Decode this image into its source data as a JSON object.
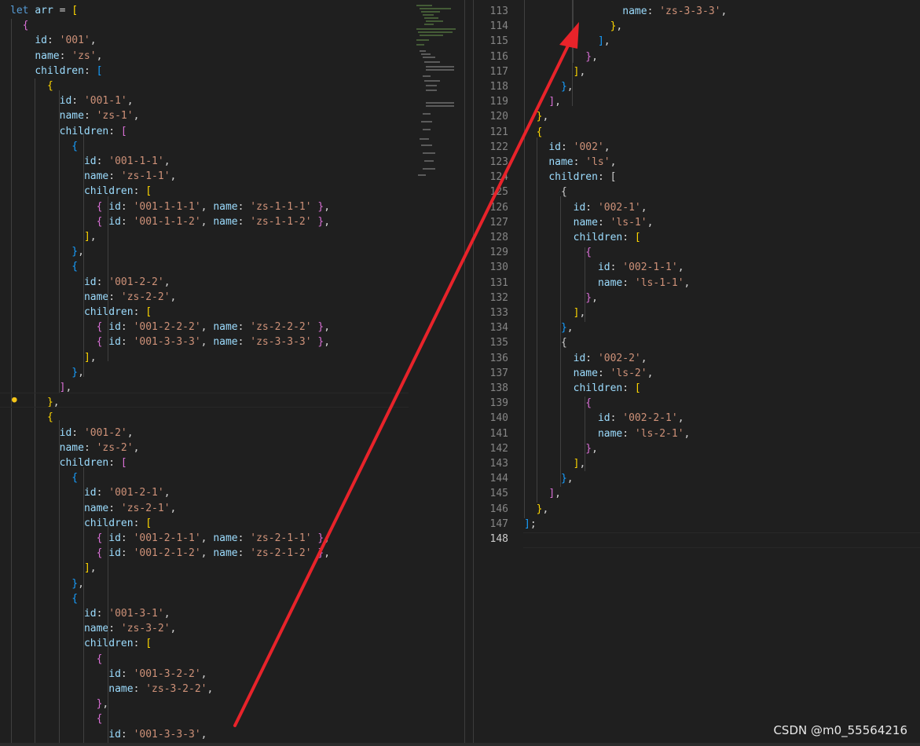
{
  "left_lines": [
    "let arr = [",
    "  {",
    "    id: '001',",
    "    name: 'zs',",
    "    children: [",
    "      {",
    "        id: '001-1',",
    "        name: 'zs-1',",
    "        children: [",
    "          {",
    "            id: '001-1-1',",
    "            name: 'zs-1-1',",
    "            children: [",
    "              { id: '001-1-1-1', name: 'zs-1-1-1' },",
    "              { id: '001-1-1-2', name: 'zs-1-1-2' },",
    "            ],",
    "          },",
    "          {",
    "            id: '001-2-2',",
    "            name: 'zs-2-2',",
    "            children: [",
    "              { id: '001-2-2-2', name: 'zs-2-2-2' },",
    "              { id: '001-3-3-3', name: 'zs-3-3-3' },",
    "            ],",
    "          },",
    "        ],",
    "      },",
    "      {",
    "        id: '001-2',",
    "        name: 'zs-2',",
    "        children: [",
    "          {",
    "            id: '001-2-1',",
    "            name: 'zs-2-1',",
    "            children: [",
    "              { id: '001-2-1-1', name: 'zs-2-1-1' },",
    "              { id: '001-2-1-2', name: 'zs-2-1-2' },",
    "            ],",
    "          },",
    "          {",
    "            id: '001-3-1',",
    "            name: 'zs-3-2',",
    "            children: [",
    "              {",
    "                id: '001-3-2-2',",
    "                name: 'zs-3-2-2',",
    "              },",
    "              {",
    "                id: '001-3-3-3',"
  ],
  "right_lines": [
    {
      "n": "113",
      "t": "                name: 'zs-3-3-3',"
    },
    {
      "n": "114",
      "t": "              },"
    },
    {
      "n": "115",
      "t": "            ],"
    },
    {
      "n": "116",
      "t": "          },"
    },
    {
      "n": "117",
      "t": "        ],"
    },
    {
      "n": "118",
      "t": "      },"
    },
    {
      "n": "119",
      "t": "    ],"
    },
    {
      "n": "120",
      "t": "  },"
    },
    {
      "n": "121",
      "t": "  {"
    },
    {
      "n": "122",
      "t": "    id: '002',"
    },
    {
      "n": "123",
      "t": "    name: 'ls',"
    },
    {
      "n": "124",
      "t": "    children: ["
    },
    {
      "n": "125",
      "t": "      {"
    },
    {
      "n": "126",
      "t": "        id: '002-1',"
    },
    {
      "n": "127",
      "t": "        name: 'ls-1',"
    },
    {
      "n": "128",
      "t": "        children: ["
    },
    {
      "n": "129",
      "t": "          {"
    },
    {
      "n": "130",
      "t": "            id: '002-1-1',"
    },
    {
      "n": "131",
      "t": "            name: 'ls-1-1',"
    },
    {
      "n": "132",
      "t": "          },"
    },
    {
      "n": "133",
      "t": "        ],"
    },
    {
      "n": "134",
      "t": "      },"
    },
    {
      "n": "135",
      "t": "      {"
    },
    {
      "n": "136",
      "t": "        id: '002-2',"
    },
    {
      "n": "137",
      "t": "        name: 'ls-2',"
    },
    {
      "n": "138",
      "t": "        children: ["
    },
    {
      "n": "139",
      "t": "          {"
    },
    {
      "n": "140",
      "t": "            id: '002-2-1',"
    },
    {
      "n": "141",
      "t": "            name: 'ls-2-1',"
    },
    {
      "n": "142",
      "t": "          },"
    },
    {
      "n": "143",
      "t": "        ],"
    },
    {
      "n": "144",
      "t": "      },"
    },
    {
      "n": "145",
      "t": "    ],"
    },
    {
      "n": "146",
      "t": "  },"
    },
    {
      "n": "147",
      "t": "];"
    },
    {
      "n": "148",
      "t": ""
    }
  ],
  "active_line": "148",
  "watermark": "CSDN @m0_55564216",
  "colors": {
    "keyword": "#569cd6",
    "property": "#9cdcfe",
    "string": "#ce9178",
    "arrow": "#e8232a"
  },
  "icons": {
    "bulb": "lightbulb-icon"
  }
}
